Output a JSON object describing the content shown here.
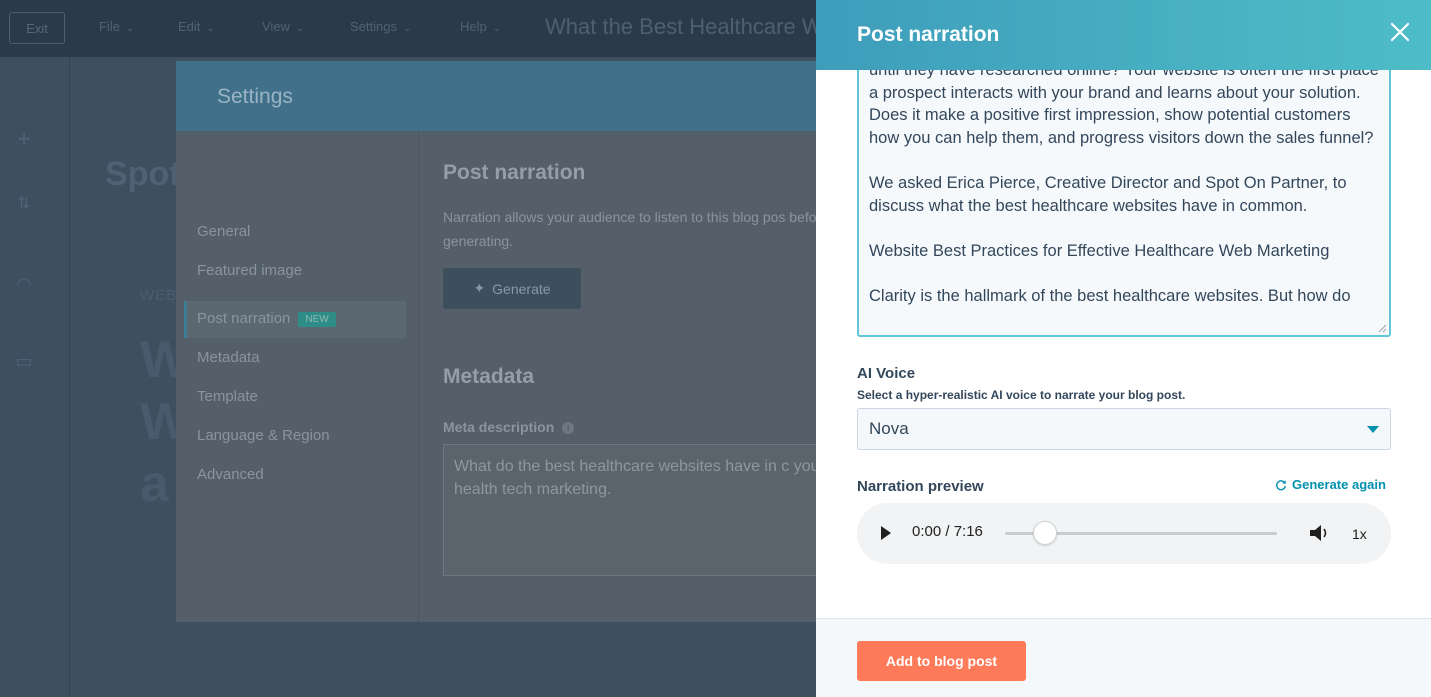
{
  "editor": {
    "exit_label": "Exit",
    "menus": [
      "File",
      "Edit",
      "View",
      "Settings",
      "Help"
    ],
    "doc_title": "What the Best Healthcare W",
    "canvas_title": "Spot",
    "canvas_subtitle": "WEB",
    "canvas_letters": [
      "W",
      "W",
      "a"
    ]
  },
  "settings_modal": {
    "title": "Settings",
    "nav_items": [
      "General",
      "Featured image",
      "Post narration",
      "Metadata",
      "Template",
      "Language & Region",
      "Advanced"
    ],
    "new_badge": "NEW",
    "narration_heading": "Post narration",
    "narration_description": "Narration allows your audience to listen to this blog pos before generating.",
    "generate_label": "Generate",
    "metadata_heading": "Metadata",
    "meta_description_label": "Meta description",
    "meta_description_value": "What do the best healthcare websites have in c your health tech marketing."
  },
  "panel": {
    "title": "Post narration",
    "narration_paragraphs": [
      "until they have researched online? Your website is often the first place a prospect interacts with your brand and learns about your solution. Does it make a positive first impression, show potential customers how you can help them, and progress visitors down the sales funnel?",
      "We asked Erica Pierce, Creative Director and Spot On Partner, to discuss what the best healthcare websites have in common.",
      "Website Best Practices for Effective Healthcare Web Marketing",
      "Clarity is the hallmark of the best healthcare websites. But how do"
    ],
    "voice": {
      "label": "AI Voice",
      "help": "Select a hyper-realistic AI voice to narrate your blog post.",
      "selected": "Nova"
    },
    "preview": {
      "label": "Narration preview",
      "regenerate_label": "Generate again",
      "time": "0:00 / 7:16",
      "progress_fraction": 0,
      "speed": "1x"
    },
    "add_button_label": "Add to blog post"
  },
  "colors": {
    "header_gradient_start": "#3e9dbb",
    "header_gradient_end": "#4ebdc7",
    "accent": "#0091ae",
    "primary_button": "#ff7a59",
    "text": "#33475b",
    "overlay": "#2f3e4c"
  },
  "icons": {
    "close": "close-icon",
    "refresh": "refresh-icon",
    "play": "play-icon",
    "volume": "volume-icon",
    "sparkle": "sparkle-icon",
    "caret": "caret-down-icon"
  }
}
